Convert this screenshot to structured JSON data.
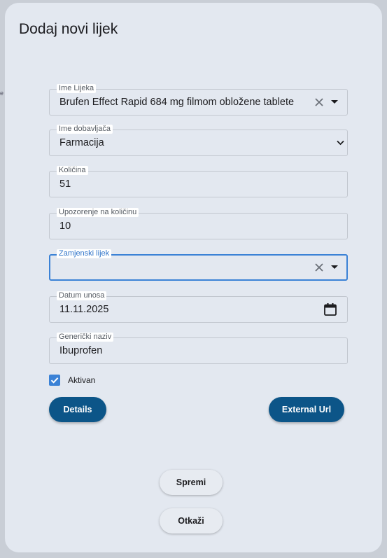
{
  "backdrop": {
    "edge_text": "e"
  },
  "dialog": {
    "title": "Dodaj novi lijek",
    "fields": {
      "ime_lijeka": {
        "label": "Ime Lijeka",
        "value": "Brufen Effect Rapid 684 mg filmom obložene tablete"
      },
      "ime_dobavljaca": {
        "label": "Ime dobavljača",
        "value": "Farmacija"
      },
      "kolicina": {
        "label": "Količina",
        "value": "51"
      },
      "upozorenje": {
        "label": "Upozorenje na količinu",
        "value": "10"
      },
      "zamjenski_lijek": {
        "label": "Zamjenski lijek",
        "value": ""
      },
      "datum_unosa": {
        "label": "Datum unosa",
        "value": "11.11.2025"
      },
      "genericki_naziv": {
        "label": "Generički naziv",
        "value": "Ibuprofen"
      }
    },
    "aktivan": {
      "label": "Aktivan",
      "checked": true
    },
    "buttons": {
      "details": "Details",
      "external_url": "External Url",
      "spremi": "Spremi",
      "otkazi": "Otkaži"
    }
  },
  "colors": {
    "accent": "#3b82d6",
    "primary_button": "#0c5588",
    "dialog_bg": "#e3e8f0"
  },
  "icons": [
    "clear-icon",
    "dropdown-arrow-icon",
    "chevron-down-icon",
    "calendar-icon",
    "checkmark-icon"
  ]
}
